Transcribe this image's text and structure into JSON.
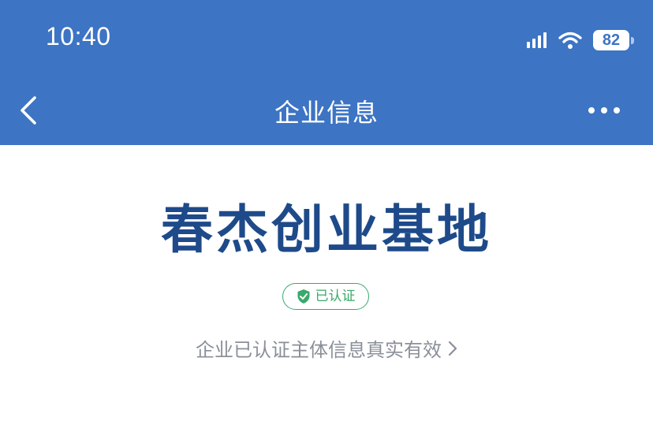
{
  "status_bar": {
    "time": "10:40",
    "battery": "82",
    "signal_icon": "cellular-signal-icon",
    "wifi_icon": "wifi-icon"
  },
  "nav_bar": {
    "title": "企业信息",
    "back_icon": "chevron-left-icon",
    "more_icon": "more-dots-icon"
  },
  "company": {
    "name": "春杰创业基地",
    "badge_label": "已认证",
    "badge_icon": "verified-shield-icon",
    "info_text": "企业已认证主体信息真实有效",
    "info_chevron": "chevron-right-icon"
  },
  "colors": {
    "header_bg": "#3d74c4",
    "company_name": "#1e4a8a",
    "verified_green": "#3aa96b",
    "info_gray": "#8a8f99"
  }
}
